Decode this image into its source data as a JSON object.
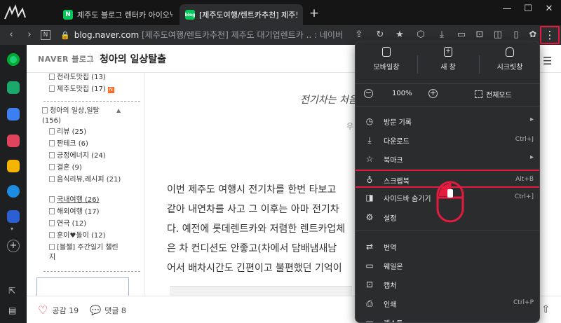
{
  "browser": {
    "tabs": [
      {
        "label": "제주도 블로그 렌터카 아이오닉",
        "favicon": "N",
        "active": false
      },
      {
        "label": "[제주도여행/렌트카추천] 제주도",
        "favicon": "blog",
        "active": true
      }
    ],
    "address": {
      "host": "blog.naver.com",
      "path": " [제주도여행/렌트카추천] 제주도 대기업렌트카 .. : 네이버"
    }
  },
  "blog": {
    "logo": "NAVER 블로그",
    "title": "청아의 일상탈출",
    "categories": [
      {
        "label": "전라도맛집 (13)"
      },
      {
        "label": "제주도맛집 (17)",
        "new": true
      },
      {
        "label": "청아의 일상,일탈 (156)"
      },
      {
        "label": "리뷰 (25)"
      },
      {
        "label": "짠테크 (6)"
      },
      {
        "label": "긍정에너지 (24)"
      },
      {
        "label": "결혼 (9)"
      },
      {
        "label": "음식리뷰,레시피 (21)"
      },
      {
        "label": "국내여행 (26)"
      },
      {
        "label": "해외여행 (17)"
      },
      {
        "label": "연극 (12)"
      },
      {
        "label": "훈이♥돌이 (12)"
      },
      {
        "label": "[블챌] 주간일기 챌린지"
      }
    ],
    "italic_text": "전기차는 처음",
    "sub_text": "우",
    "paragraph": [
      "이번 제주도 여행시 전기차를 한번 타보고",
      "같아 내연차를 사고 그 이후는 아마 전기차",
      "다. 예전에 롯데렌트카와 저렴한 렌트카업체",
      "은 차 컨디션도 안좋고(차에서 담배냄새남",
      "어서 배차시간도 긴편이고 불편했던 기억이"
    ],
    "likes": "공감 19",
    "comments": "댓글 8"
  },
  "menu": {
    "quick_actions": [
      "모바일창",
      "새 창",
      "시크릿창"
    ],
    "zoom": "100%",
    "fullscreen": "전체모드",
    "items": [
      {
        "label": "방문 기록",
        "icon": "history-icon",
        "shortcut": "",
        "arrow": true
      },
      {
        "label": "다운로드",
        "icon": "download-icon",
        "shortcut": "Ctrl+J",
        "arrow": false
      },
      {
        "label": "북마크",
        "icon": "bookmark-icon",
        "shortcut": "",
        "arrow": true
      },
      {
        "label": "스크랩북",
        "icon": "scrapbook-icon",
        "shortcut": "Alt+B",
        "arrow": false,
        "highlighted": true
      },
      {
        "label": "사이드바 숨기기",
        "icon": "sidebar-icon",
        "shortcut": "Ctrl+]",
        "arrow": false
      },
      {
        "label": "설정",
        "icon": "settings-icon",
        "shortcut": "",
        "arrow": false
      },
      {
        "label": "번역",
        "icon": "translate-icon",
        "shortcut": "",
        "arrow": false
      },
      {
        "label": "웨일온",
        "icon": "whale-on-icon",
        "shortcut": "",
        "arrow": false
      },
      {
        "label": "캡처",
        "icon": "capture-icon",
        "shortcut": "",
        "arrow": false
      },
      {
        "label": "인쇄",
        "icon": "print-icon",
        "shortcut": "Ctrl+P",
        "arrow": false
      },
      {
        "label": "캐스트",
        "icon": "cast-icon",
        "shortcut": "",
        "arrow": false
      }
    ]
  },
  "colors": {
    "highlight": "#e51a3f",
    "naver_green": "#03c75a",
    "menu_bg": "#2b2c2e"
  }
}
